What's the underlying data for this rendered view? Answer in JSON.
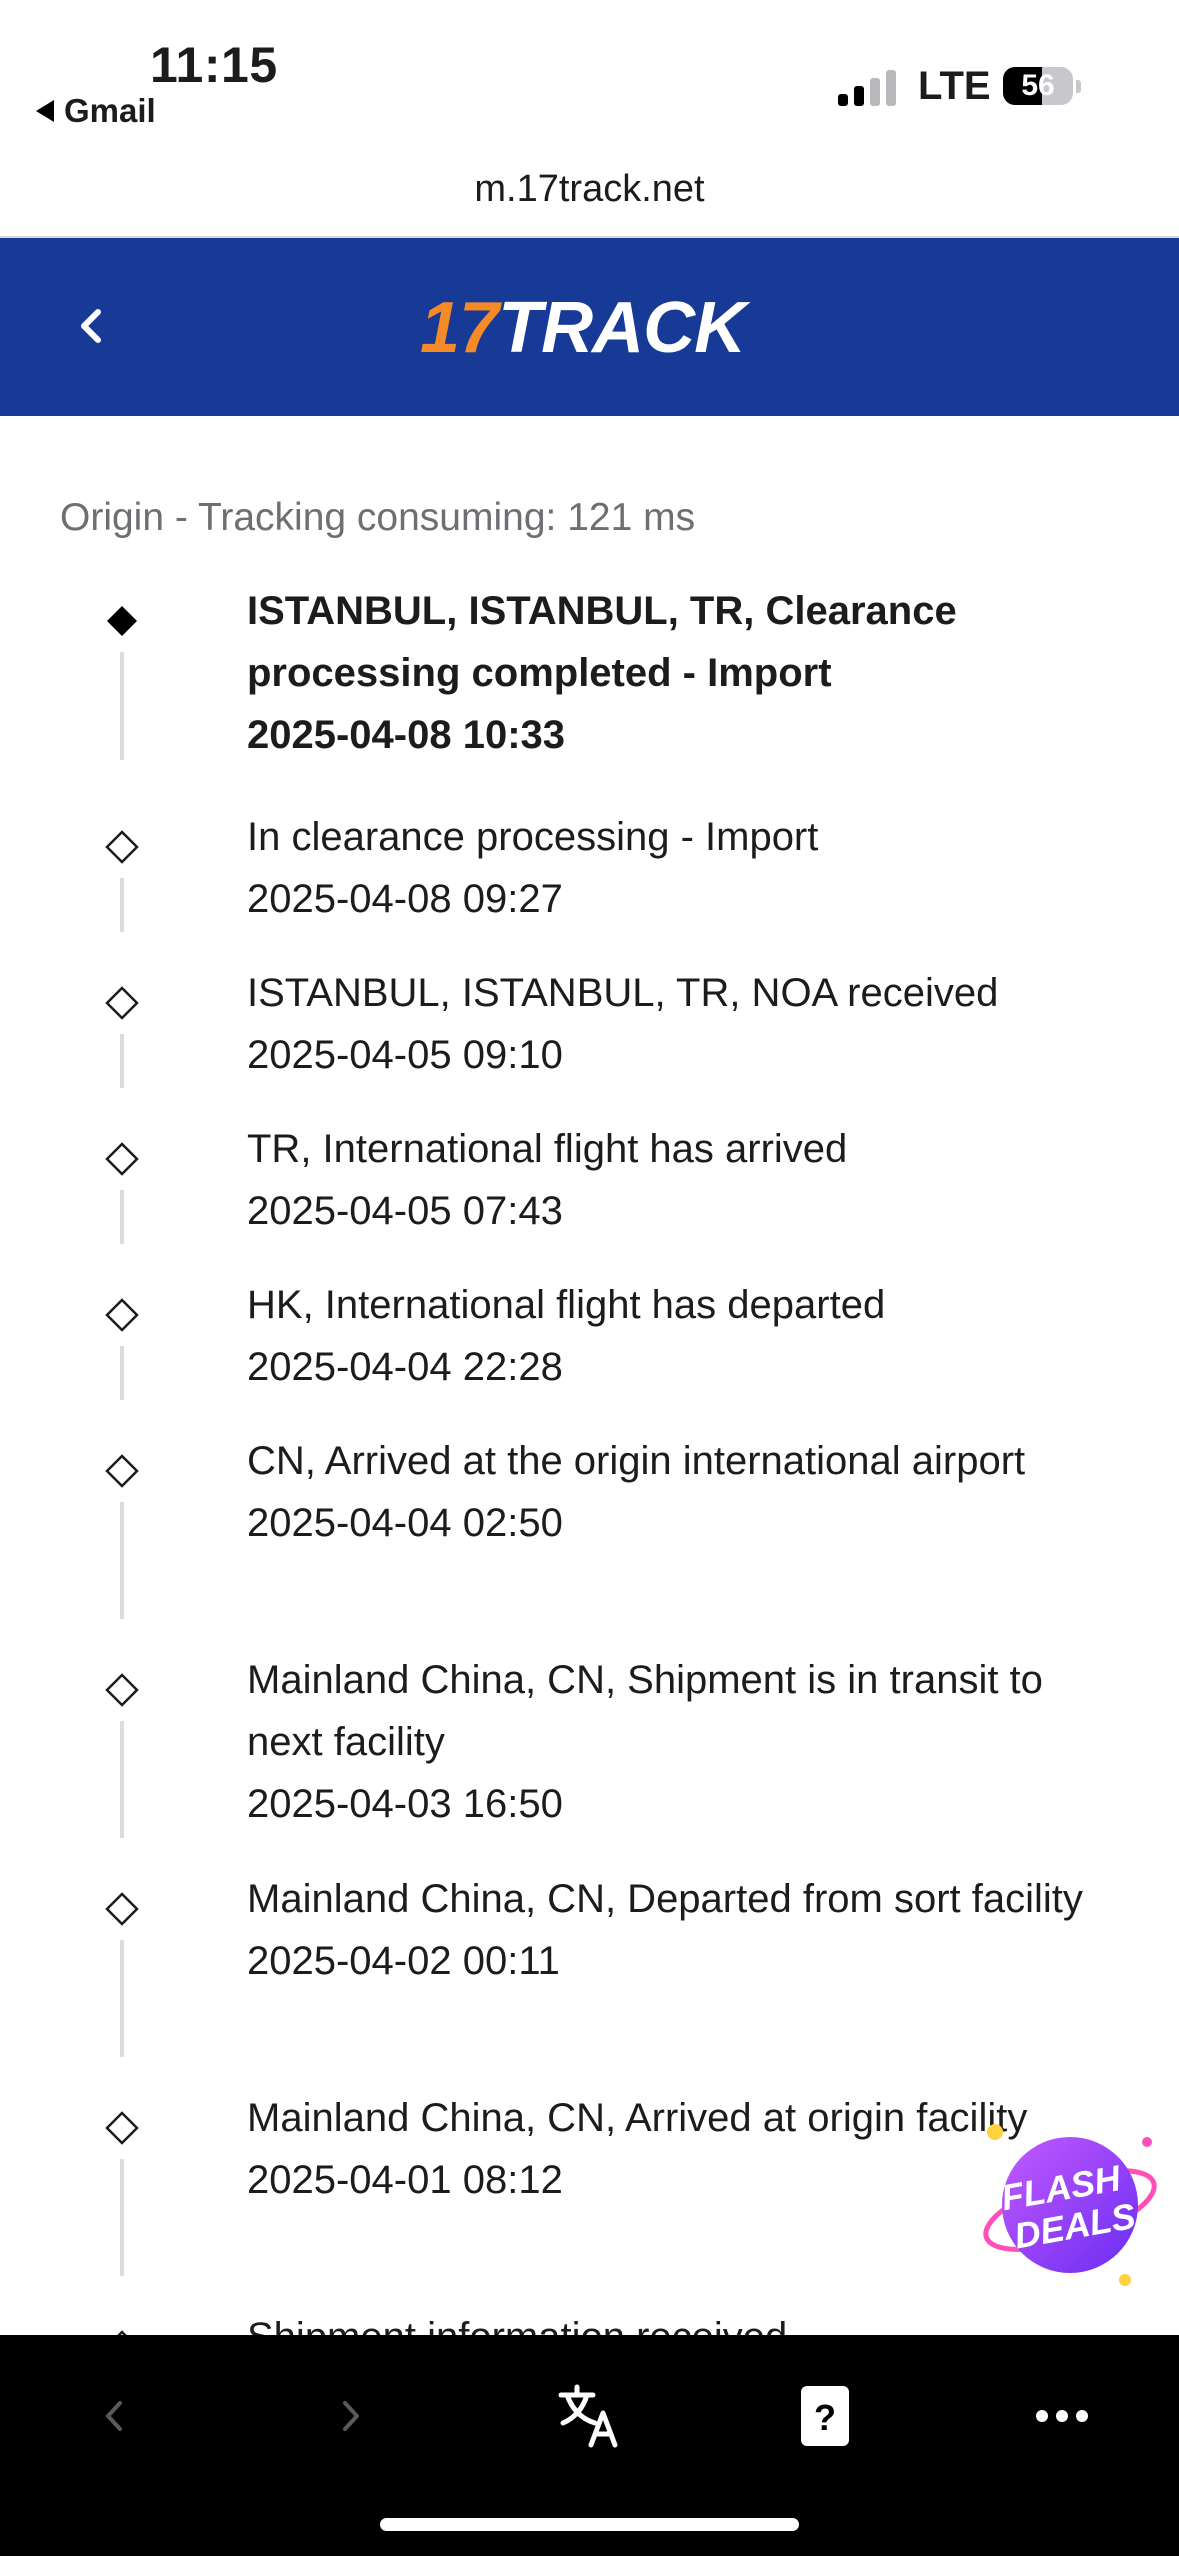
{
  "status_bar": {
    "time": "11:15",
    "back_app": "Gmail",
    "network": "LTE",
    "battery": "56",
    "battery_level": 0.56
  },
  "browser": {
    "url": "m.17track.net"
  },
  "header": {
    "logo_number": "17",
    "logo_word": "TRACK",
    "background_color": "#163a96",
    "accent_color": "#f58a28"
  },
  "tracking": {
    "subtitle": "Origin - Tracking consuming: 121 ms",
    "events": [
      {
        "description": "ISTANBUL, ISTANBUL, TR, Clearance processing completed - Import",
        "datetime": "2025-04-08 10:33",
        "current": true
      },
      {
        "description": "In clearance processing - Import",
        "datetime": "2025-04-08 09:27",
        "current": false
      },
      {
        "description": "ISTANBUL, ISTANBUL, TR, NOA received",
        "datetime": "2025-04-05 09:10",
        "current": false
      },
      {
        "description": "TR, International flight has arrived",
        "datetime": "2025-04-05 07:43",
        "current": false
      },
      {
        "description": "HK, International flight has departed",
        "datetime": "2025-04-04 22:28",
        "current": false
      },
      {
        "description": "CN, Arrived at the origin international airport",
        "datetime": "2025-04-04 02:50",
        "current": false
      },
      {
        "description": "Mainland China, CN, Shipment is in transit to next facility",
        "datetime": "2025-04-03 16:50",
        "current": false
      },
      {
        "description": "Mainland China, CN, Departed from sort facility",
        "datetime": "2025-04-02 00:11",
        "current": false
      },
      {
        "description": "Mainland China, CN, Arrived at origin facility",
        "datetime": "2025-04-01 08:12",
        "current": false
      },
      {
        "description": "Shipment information received",
        "datetime": "",
        "current": false
      }
    ]
  },
  "flash_deals": {
    "line1": "FLASH",
    "line2": "DEALS"
  },
  "toolbar": {
    "items": [
      "back-icon",
      "forward-icon",
      "translate-icon",
      "help-icon",
      "more-icon"
    ]
  }
}
